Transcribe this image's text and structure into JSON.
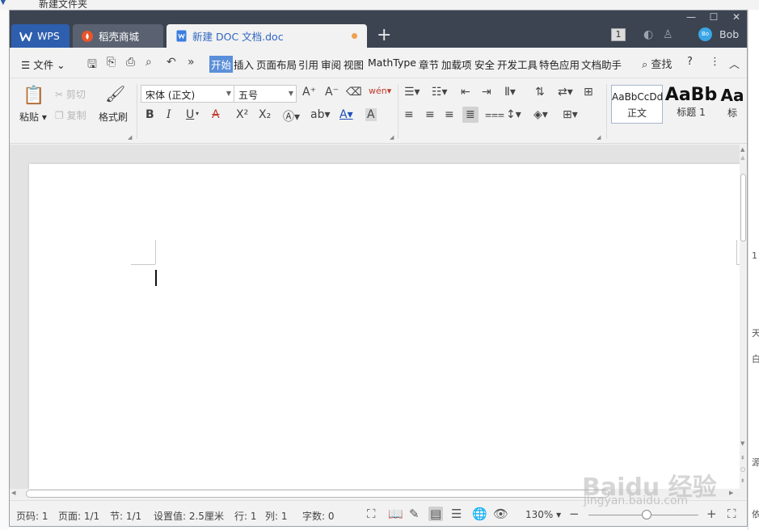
{
  "background": {
    "folder_label": "新建文件夹",
    "right_fragments": [
      "1",
      "天",
      "白",
      "源",
      "依"
    ]
  },
  "titlebar": {
    "tabs": [
      {
        "label": "WPS"
      },
      {
        "label": "稻壳商城"
      },
      {
        "label": "新建 DOC 文档.doc"
      }
    ],
    "new_tab": "+",
    "window_count": "1",
    "user": "Bob",
    "avatar_text": "Bo",
    "colors": {
      "bar": "#3c4452",
      "wps_tab": "#2e5fae",
      "unsaved_dot": "#f0a050"
    }
  },
  "menubar": {
    "file_label": "文件",
    "tabs": [
      "开始",
      "插入",
      "页面布局",
      "引用",
      "审阅",
      "视图",
      "MathType",
      "章节",
      "加载项",
      "安全",
      "开发工具",
      "特色应用",
      "文档助手"
    ],
    "active_tab": "开始",
    "search_label": "查找",
    "help": "?",
    "more": "⋮"
  },
  "ribbon": {
    "paste": "粘贴",
    "cut": "剪切",
    "copy": "复制",
    "format_painter": "格式刷",
    "font_name": "宋体 (正文)",
    "font_size": "五号",
    "bold": "B",
    "italic": "I",
    "underline": "U",
    "superscript": "X²",
    "subscript": "X₂",
    "styles": [
      {
        "preview": "AaBbCcDd",
        "label": "正文"
      },
      {
        "preview": "AaBb",
        "label": "标题 1"
      },
      {
        "preview": "Aa",
        "label": "标"
      }
    ]
  },
  "statusbar": {
    "page_code": "页码: 1",
    "page": "页面: 1/1",
    "section": "节: 1/1",
    "setting": "设置值: 2.5厘米",
    "row": "行: 1",
    "col": "列: 1",
    "word_count": "字数: 0",
    "zoom": "130%",
    "zoom_value": 130
  },
  "watermark": {
    "brand": "Baidu 经验",
    "url": "jingyan.baidu.com"
  }
}
